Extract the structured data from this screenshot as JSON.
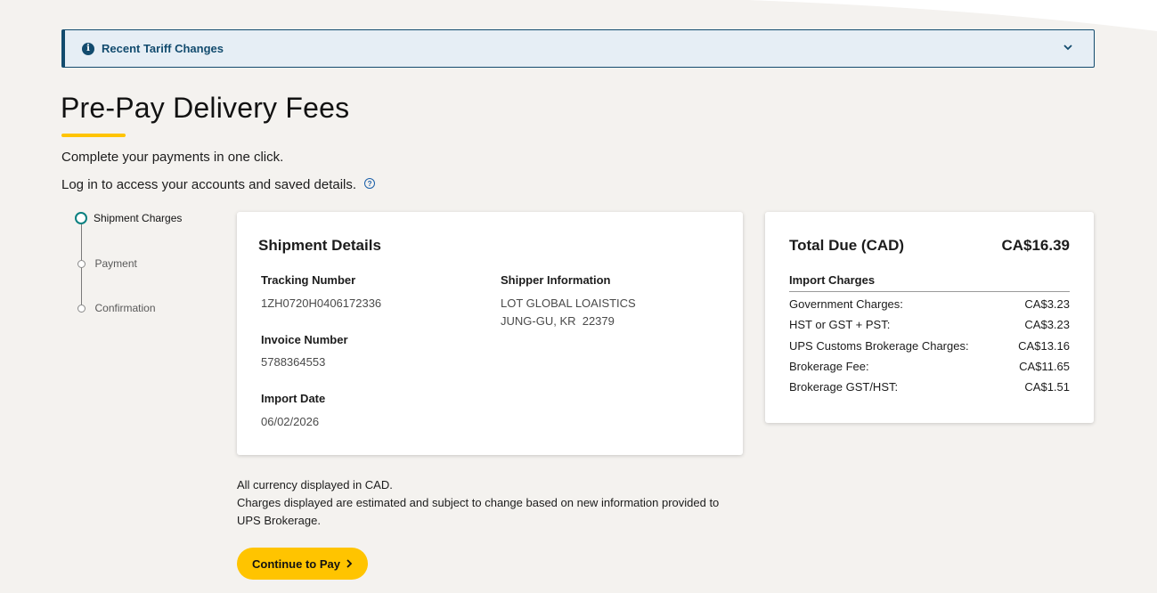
{
  "banner": {
    "label": "Recent Tariff Changes",
    "icon": "info-icon",
    "expand_icon": "chevron-down-icon"
  },
  "page": {
    "title": "Pre-Pay Delivery Fees",
    "subtitle": "Complete your payments in one click.",
    "login_text": "Log in to access your accounts and saved details.",
    "help_icon": "?"
  },
  "stepper": {
    "steps": [
      {
        "label": "Shipment Charges",
        "active": true
      },
      {
        "label": "Payment",
        "active": false
      },
      {
        "label": "Confirmation",
        "active": false
      }
    ]
  },
  "details": {
    "heading": "Shipment Details",
    "tracking_label": "Tracking Number",
    "tracking_value": "1ZH0720H0406172336",
    "invoice_label": "Invoice Number",
    "invoice_value": "5788364553",
    "import_date_label": "Import Date",
    "import_date_value": "06/02/2026",
    "shipper_label": "Shipper Information",
    "shipper_line1": "LOT GLOBAL LOAISTICS",
    "shipper_line2": "JUNG-GU, KR  22379"
  },
  "total": {
    "heading": "Total Due (CAD)",
    "amount": "CA$16.39",
    "section_title": "Import Charges",
    "rows": [
      {
        "label": "Government Charges:",
        "value": "CA$3.23"
      },
      {
        "label": "HST or GST + PST:",
        "value": "CA$3.23"
      },
      {
        "label": "UPS Customs Brokerage Charges:",
        "value": "CA$13.16"
      },
      {
        "label": "Brokerage Fee:",
        "value": "CA$11.65"
      },
      {
        "label": "Brokerage GST/HST:",
        "value": "CA$1.51"
      }
    ]
  },
  "notes": {
    "currency": "All currency displayed in CAD.",
    "estimate_line1": "Charges displayed are estimated and subject to change based on new information provided to",
    "estimate_line2": "UPS Brokerage."
  },
  "actions": {
    "continue_label": "Continue to Pay"
  },
  "colors": {
    "accent": "#ffc400",
    "banner_border": "#124b6e",
    "banner_bg": "#e6eef5",
    "step_active": "#0a8080"
  }
}
